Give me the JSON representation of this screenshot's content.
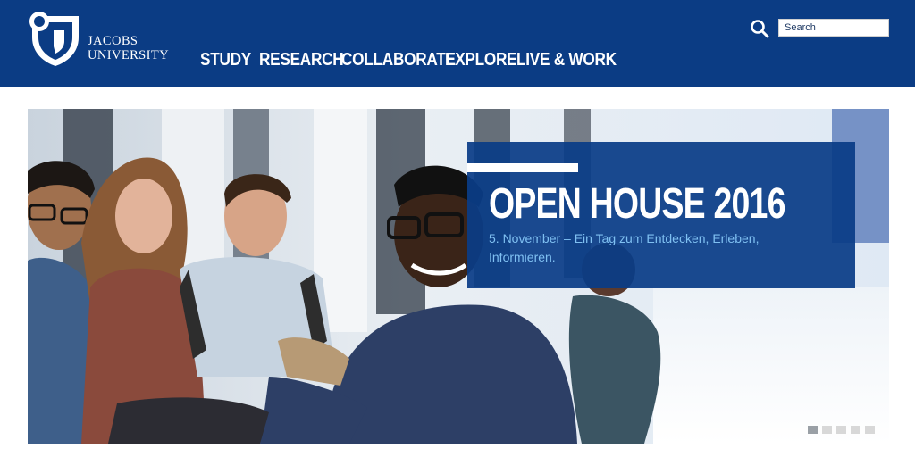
{
  "brand": {
    "logo_line1": "JACOBS",
    "logo_line2": "UNIVERSITY",
    "header_color": "#0b3c84"
  },
  "nav": {
    "items": [
      "STUDY",
      "RESEARCH",
      "COLLABORATE",
      "EXPLORE",
      "LIVE & WORK"
    ]
  },
  "search": {
    "placeholder": "Search",
    "icon": "search-icon"
  },
  "hero": {
    "title": "OPEN HOUSE 2016",
    "subtitle": "5. November – Ein Tag zum Entdecken, Erleben, Informieren.",
    "slides_total": 5,
    "active_slide": 1,
    "panel_color": "#0a3c87",
    "subtitle_color": "#7fc0f2"
  }
}
